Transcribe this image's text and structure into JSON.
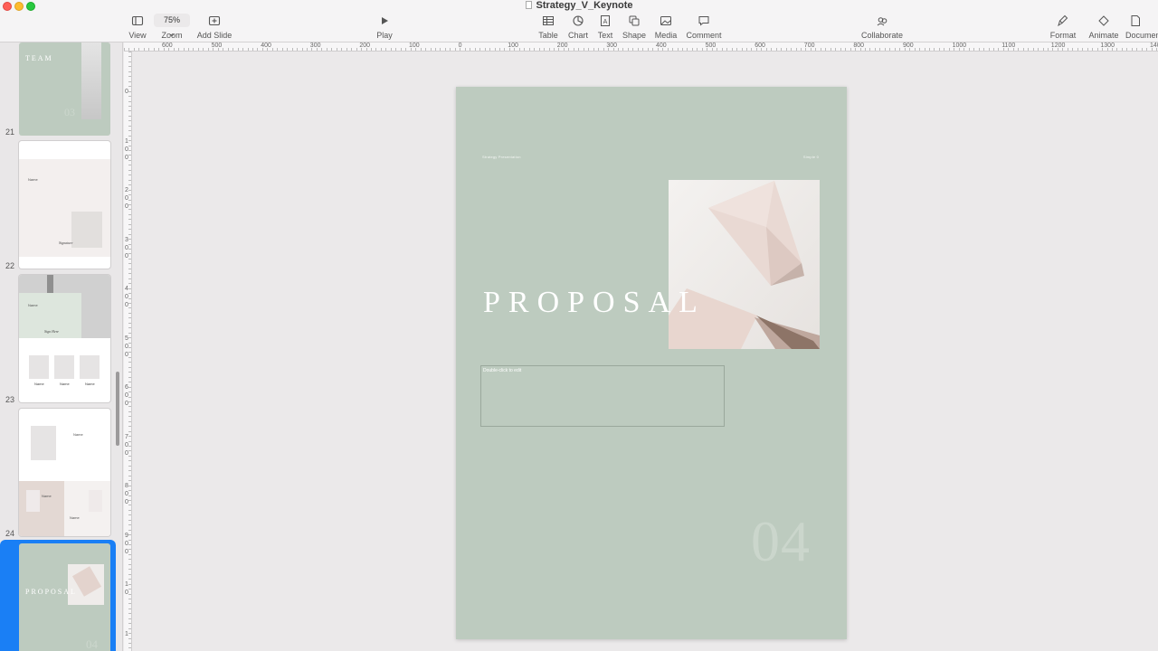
{
  "window": {
    "title": "Strategy_V_Keynote"
  },
  "toolbar": {
    "view": "View",
    "zoom_value": "75%",
    "zoom": "Zoom",
    "add_slide": "Add Slide",
    "play": "Play",
    "table": "Table",
    "chart": "Chart",
    "text": "Text",
    "shape": "Shape",
    "media": "Media",
    "comment": "Comment",
    "collaborate": "Collaborate",
    "format": "Format",
    "animate": "Animate",
    "document": "Document"
  },
  "rulers": {
    "horizontal": [
      "600",
      "500",
      "400",
      "300",
      "200",
      "100",
      "0",
      "100",
      "200",
      "300",
      "400",
      "500",
      "600",
      "700",
      "800",
      "900",
      "1000",
      "1100",
      "1200",
      "1300",
      "140"
    ],
    "vertical": [
      "0",
      "1\n0\n0",
      "2\n0\n0",
      "3\n0\n0",
      "4\n0\n0",
      "5\n0\n0",
      "6\n0\n0",
      "7\n0\n0",
      "8\n0\n0",
      "9\n0\n0",
      "1\n0",
      "1"
    ]
  },
  "navigator": {
    "slides": [
      {
        "number": "",
        "title": "TEAM",
        "page": "03"
      },
      {
        "number": "21",
        "label": "Name",
        "sig": "Signature"
      },
      {
        "number": "22",
        "label": "Name",
        "sig": "Sign Here",
        "names": [
          "Name",
          "Name",
          "Name"
        ]
      },
      {
        "number": "23",
        "label": "Name",
        "names": [
          "Name",
          "Name"
        ]
      },
      {
        "number": "24",
        "title": "PROPOSAL",
        "page": "04"
      }
    ]
  },
  "slide": {
    "top_left": "Strategy Presentation",
    "top_right": "Simple 0",
    "title": "PROPOSAL",
    "placeholder": "Double-click to edit",
    "page": "04"
  }
}
